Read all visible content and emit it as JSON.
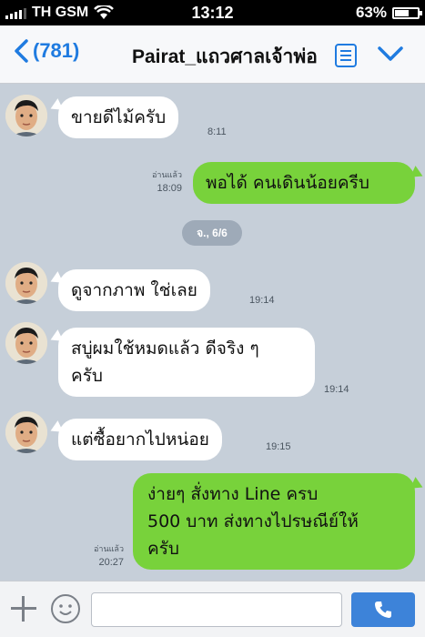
{
  "status_bar": {
    "carrier": "TH GSM",
    "time": "13:12",
    "battery": "63%",
    "battery_level": 0.63
  },
  "header": {
    "back_count": "(781)",
    "title": "Pairat_แถวศาลเจ้าพ่อ"
  },
  "chat": {
    "date_separator": "จ., 6/6",
    "messages": [
      {
        "direction": "in",
        "text": "ขายดีไม้ครับ",
        "time": "8:11"
      },
      {
        "direction": "out",
        "text": "พอได้ คนเดินน้อยครีบ",
        "time": "18:09",
        "read_label": "อ่านแล้ว"
      },
      {
        "direction": "in",
        "text": "ดูจากภาพ ใช่เลย",
        "time": "19:14"
      },
      {
        "direction": "in",
        "text_lines": [
          "สบู่ผมใช้หมดแล้ว ดีจริง ๆ",
          "ครับ"
        ],
        "time": "19:14"
      },
      {
        "direction": "in",
        "text": "แต่ซื้อยากไปหน่อย",
        "time": "19:15"
      },
      {
        "direction": "out",
        "text_lines": [
          "ง่ายๆ สั่งทาง Line ครบ",
          "500 บาท ส่งทางไปรษณีย์ให้",
          "ครับ"
        ],
        "time": "20:27",
        "read_label": "อ่านแล้ว"
      }
    ]
  },
  "input_bar": {
    "placeholder": ""
  },
  "colors": {
    "accent": "#1f7be0",
    "chat_background": "#c6cfd9",
    "incoming_bubble": "#ffffff",
    "outgoing_bubble": "#78d23b",
    "call_button": "#3d83d9"
  }
}
